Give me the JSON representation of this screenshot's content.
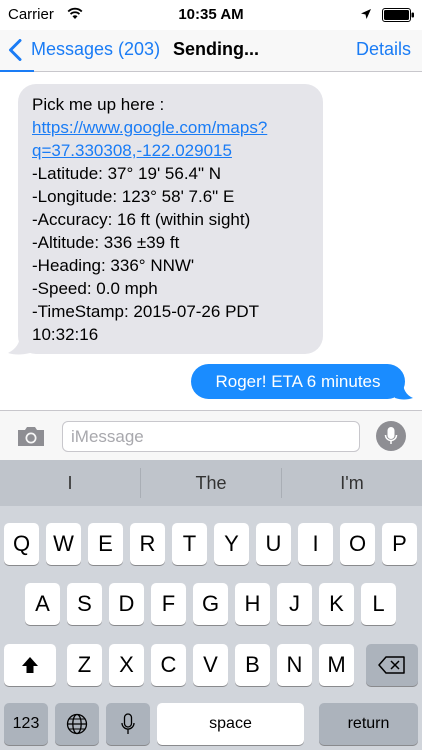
{
  "status_bar": {
    "carrier": "Carrier",
    "time": "10:35 AM"
  },
  "nav_bar": {
    "back_label": "Messages (203)",
    "title": "Sending...",
    "details_label": "Details",
    "send_progress": 0.08
  },
  "conversation": {
    "incoming_lines": [
      "Pick me up here :",
      "https://www.google.com/maps?",
      "q=37.330308,-122.029015",
      "-Latitude: 37° 19' 56.4\" N",
      "-Longitude: 123° 58' 7.6\" E",
      "-Accuracy: 16 ft (within sight)",
      "-Altitude: 336 ±39 ft",
      "-Heading: 336° NNW'",
      "-Speed: 0.0 mph",
      "-TimeStamp: 2015-07-26 PDT",
      "10:32:16"
    ],
    "outgoing_text": "Roger! ETA 6 minutes"
  },
  "input_bar": {
    "placeholder": "iMessage",
    "value": ""
  },
  "keyboard": {
    "suggestions": [
      "I",
      "The",
      "I'm"
    ],
    "row1": [
      "Q",
      "W",
      "E",
      "R",
      "T",
      "Y",
      "U",
      "I",
      "O",
      "P"
    ],
    "row2": [
      "A",
      "S",
      "D",
      "F",
      "G",
      "H",
      "J",
      "K",
      "L"
    ],
    "row3": [
      "Z",
      "X",
      "C",
      "V",
      "B",
      "N",
      "M"
    ],
    "numbers_label": "123",
    "space_label": "space",
    "return_label": "return"
  },
  "colors": {
    "accent": "#1a7cf5",
    "outgoing_bubble": "#1a8cff",
    "incoming_bubble": "#e5e5ea",
    "keyboard_bg": "#d1d5db"
  },
  "icons": [
    "wifi-icon",
    "location-icon",
    "battery-icon",
    "back-chevron-icon",
    "camera-icon",
    "mic-icon",
    "shift-icon",
    "backspace-icon",
    "globe-icon",
    "dictation-mic-icon"
  ]
}
